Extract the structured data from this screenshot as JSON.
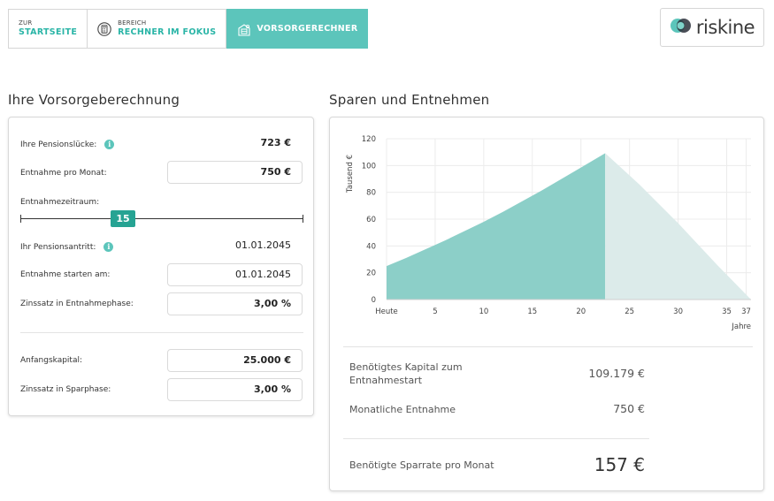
{
  "nav": {
    "home": {
      "small": "ZUR",
      "big": "STARTSEITE"
    },
    "area": {
      "small": "BEREICH",
      "big": "RECHNER IM FOKUS"
    },
    "current": {
      "big": "VORSORGERECHNER"
    }
  },
  "logo": {
    "text": "riskine"
  },
  "left": {
    "title": "Ihre Vorsorgeberechnung",
    "pension_gap": {
      "label": "Ihre Pensionslücke:",
      "value": "723 €"
    },
    "monthly_withdrawal": {
      "label": "Entnahme pro Monat:",
      "value": "750 €"
    },
    "withdrawal_period": {
      "label": "Entnahmezeitraum:",
      "value": "15",
      "min": 0,
      "max": 40
    },
    "pension_start": {
      "label": "Ihr Pensionsantritt:",
      "value": "01.01.2045"
    },
    "withdrawal_start": {
      "label": "Entnahme starten am:",
      "value": "01.01.2045"
    },
    "interest_withdrawal": {
      "label": "Zinssatz in Entnahmephase:",
      "value": "3,00 %"
    },
    "initial_capital": {
      "label": "Anfangskapital:",
      "value": "25.000 €"
    },
    "interest_saving": {
      "label": "Zinssatz in Sparphase:",
      "value": "3,00 %"
    }
  },
  "right": {
    "title": "Sparen und Entnehmen",
    "summary": {
      "required_capital": {
        "label_line1": "Benötigtes Kapital zum",
        "label_line2": "Entnahmestart",
        "value": "109.179 €"
      },
      "monthly_withdrawal": {
        "label": "Monatliche Entnahme",
        "value": "750 €"
      },
      "savings_rate": {
        "label": "Benötigte Sparrate pro Monat",
        "value": "157 €"
      }
    }
  },
  "chart_data": {
    "type": "area",
    "ylabel": "Tausend €",
    "xlabel": "Jahre",
    "x_tick_labels": [
      "Heute",
      "5",
      "10",
      "15",
      "20",
      "25",
      "30",
      "35",
      "37"
    ],
    "x_ticks": [
      0,
      5,
      10,
      15,
      20,
      25,
      30,
      35,
      37
    ],
    "y_ticks": [
      0,
      20,
      40,
      60,
      80,
      100,
      120
    ],
    "xlim": [
      0,
      37.5
    ],
    "ylim": [
      0,
      120
    ],
    "grid": true,
    "series": [
      {
        "role": "saving",
        "color": "#8ccfc8",
        "x": [
          0,
          2,
          4,
          6,
          8,
          10,
          12,
          14,
          16,
          18,
          20,
          22.5
        ],
        "y": [
          25,
          31,
          37.5,
          44,
          51,
          58,
          65.5,
          73.5,
          81.5,
          90,
          98.5,
          109.2
        ]
      },
      {
        "role": "withdrawal",
        "color": "#dcebea",
        "x": [
          22.5,
          26,
          30,
          34,
          37.5
        ],
        "y": [
          109.2,
          86,
          57,
          26,
          0
        ]
      }
    ]
  },
  "colors": {
    "accent": "#5cc5bb",
    "accent_dark": "#26a393",
    "border": "#d9d9d9"
  }
}
